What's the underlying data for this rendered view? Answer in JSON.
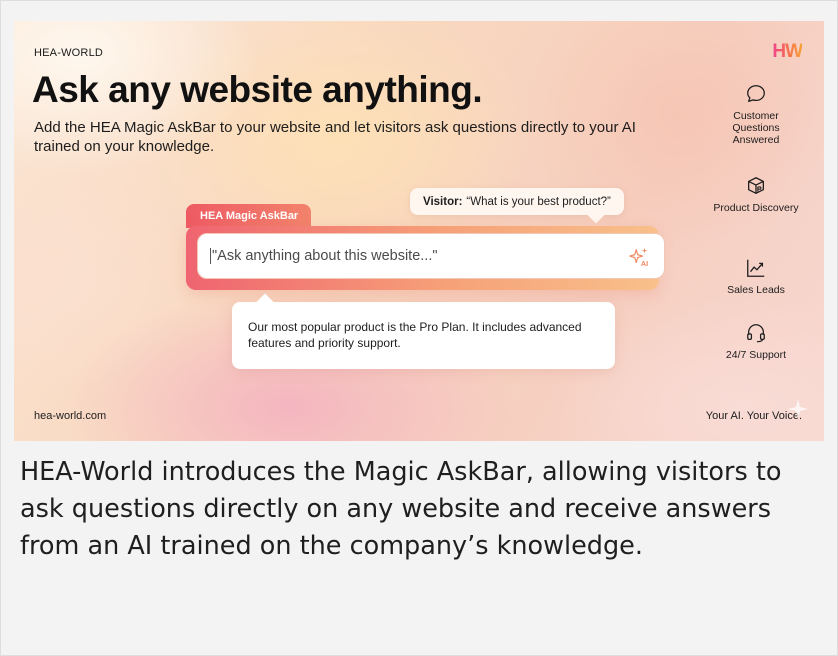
{
  "hero": {
    "brand": "HEA-WORLD",
    "logo_text": "HW",
    "headline": "Ask any website anything.",
    "subhead": "Add the HEA Magic AskBar to your website and let visitors ask questions directly to your AI trained on your knowledge.",
    "visitor_bubble": {
      "speaker": "Visitor:",
      "quote": "“What is your best product?”"
    },
    "askbar": {
      "tab_label": "HEA Magic AskBar",
      "placeholder": "\"Ask anything about this website...\"",
      "ai_icon": "sparkle-ai-icon"
    },
    "answer": "Our most popular product is the Pro Plan. It includes advanced features and priority support.",
    "features": [
      {
        "icon": "chat-bubble-icon",
        "label": "Customer Questions Answered"
      },
      {
        "icon": "product-box-icon",
        "label": "Product Discovery"
      },
      {
        "icon": "trend-chart-icon",
        "label": "Sales Leads"
      },
      {
        "icon": "headset-icon",
        "label": "24/7 Support"
      }
    ],
    "footer_left": "hea-world.com",
    "footer_right": "Your AI. Your Voice."
  },
  "caption": "HEA-World introduces the Magic AskBar, allowing visitors to ask questions directly on any website and receive answers from an AI trained on the company’s knowledge.",
  "colors": {
    "accent_pink": "#f0428d",
    "accent_orange": "#f6744a",
    "askbar_red": "#ee5a63",
    "text_dark": "#111111"
  }
}
